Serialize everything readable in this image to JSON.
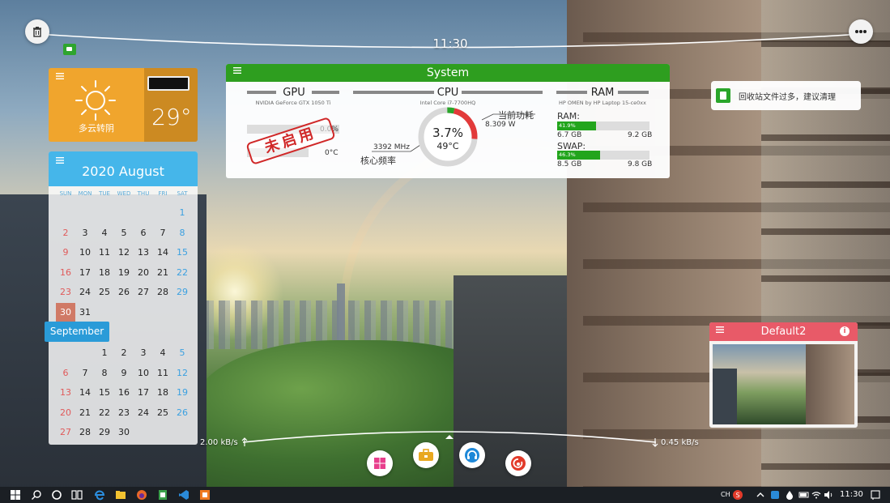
{
  "topbar": {
    "time": "11:30"
  },
  "weather": {
    "condition": "多云转阴",
    "temperature": "29°"
  },
  "calendar": {
    "title": "2020 August",
    "weekdays": [
      "SUN",
      "MON",
      "TUE",
      "WED",
      "THU",
      "FRI",
      "SAT"
    ],
    "august_rows": [
      [
        "",
        "",
        "",
        "",
        "",
        "",
        "1"
      ],
      [
        "2",
        "3",
        "4",
        "5",
        "6",
        "7",
        "8"
      ],
      [
        "9",
        "10",
        "11",
        "12",
        "13",
        "14",
        "15"
      ],
      [
        "16",
        "17",
        "18",
        "19",
        "20",
        "21",
        "22"
      ],
      [
        "23",
        "24",
        "25",
        "26",
        "27",
        "28",
        "29"
      ],
      [
        "30",
        "31",
        "",
        "",
        "",
        "",
        ""
      ]
    ],
    "today": "30",
    "next_month_label": "September",
    "september_rows": [
      [
        "",
        "",
        "1",
        "2",
        "3",
        "4",
        "5"
      ],
      [
        "6",
        "7",
        "8",
        "9",
        "10",
        "11",
        "12"
      ],
      [
        "13",
        "14",
        "15",
        "16",
        "17",
        "18",
        "19"
      ],
      [
        "20",
        "21",
        "22",
        "23",
        "24",
        "25",
        "26"
      ],
      [
        "27",
        "28",
        "29",
        "30",
        "",
        "",
        ""
      ]
    ]
  },
  "system": {
    "title": "System",
    "gpu": {
      "label": "GPU",
      "model": "NVIDIA GeForce GTX 1050 Ti",
      "usage": "0.0%",
      "temp": "0°C",
      "stamp": "未启用"
    },
    "cpu": {
      "label": "CPU",
      "model": "Intel Core i7-7700HQ",
      "usage": "3.7%",
      "usage_fraction": 0.037,
      "temp": "49°C",
      "power_label": "当前功耗",
      "power": "8.309 W",
      "freq": "3392 MHz",
      "freq_label": "核心频率"
    },
    "ram": {
      "label": "RAM",
      "model": "HP OMEN by HP Laptop 15-ce0xx",
      "ram_label": "RAM:",
      "ram_pct": "41.9%",
      "ram_fraction": 0.419,
      "ram_used": "6.7 GB",
      "ram_total": "9.2 GB",
      "swap_label": "SWAP:",
      "swap_pct": "46.3%",
      "swap_fraction": 0.463,
      "swap_used": "8.5 GB",
      "swap_total": "9.8 GB"
    }
  },
  "notification": {
    "text": "回收站文件过多，建议清理"
  },
  "default2": {
    "title": "Default2"
  },
  "network": {
    "upload": "2.00 kB/s",
    "download": "0.45 kB/s"
  },
  "taskbar": {
    "time": "11:30",
    "lang": "CH"
  },
  "colors": {
    "accent_green": "#2e9e1f",
    "weather_orange": "#f0a52d",
    "calendar_blue": "#45b6ea",
    "default2_red": "#e85a68"
  }
}
